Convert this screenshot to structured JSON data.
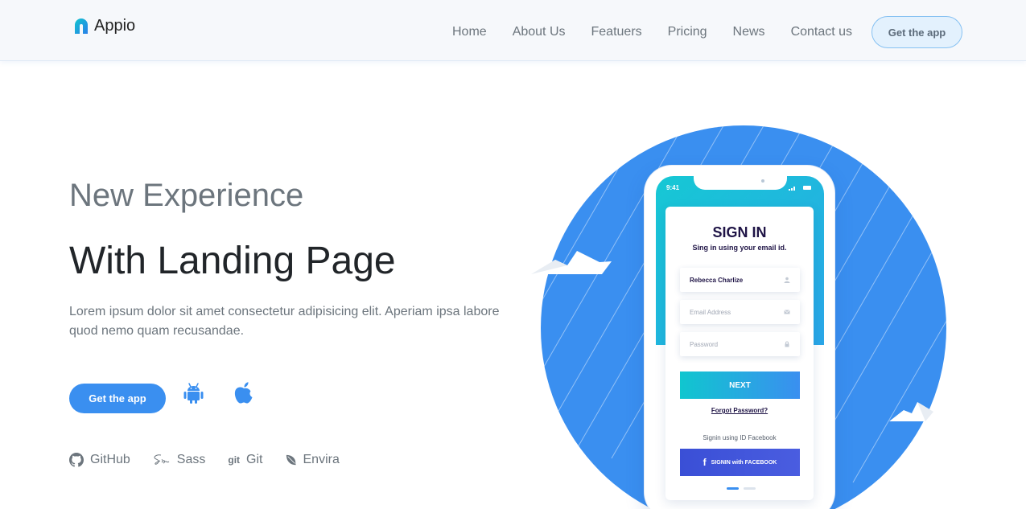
{
  "brand": {
    "name": "Appio",
    "accent": "#3a8ff0"
  },
  "nav": {
    "items": [
      "Home",
      "About Us",
      "Featuers",
      "Pricing",
      "News",
      "Contact us"
    ],
    "cta": "Get the app"
  },
  "hero": {
    "subtitle": "New Experience",
    "title": "With Landing Page",
    "description": "Lorem ipsum dolor sit amet consectetur adipisicing elit. Aperiam ipsa labore quod nemo quam recusandae.",
    "cta": "Get the app",
    "store_icons": [
      "android-icon",
      "apple-icon"
    ]
  },
  "tech": [
    {
      "icon": "github-icon",
      "label": "GitHub"
    },
    {
      "icon": "sass-icon",
      "label": "Sass"
    },
    {
      "icon": "git-icon",
      "badge": "git",
      "label": "Git"
    },
    {
      "icon": "envira-icon",
      "label": "Envira"
    }
  ],
  "phone": {
    "time": "9:41",
    "title": "SIGN IN",
    "subtitle": "Sing in using your email id.",
    "fields": [
      {
        "value": "Rebecca Charlize",
        "placeholder": "",
        "icon": "user-icon"
      },
      {
        "value": "",
        "placeholder": "Email Address",
        "icon": "mail-icon"
      },
      {
        "value": "",
        "placeholder": "Password",
        "icon": "lock-icon"
      }
    ],
    "next": "NEXT",
    "forgot": "Forgot Password?",
    "fb_note": "Signin using ID Facebook",
    "fb_icon": "f",
    "fb_button": "SIGNIN with FACEBOOK",
    "page": {
      "current": 1,
      "total": 2
    }
  }
}
